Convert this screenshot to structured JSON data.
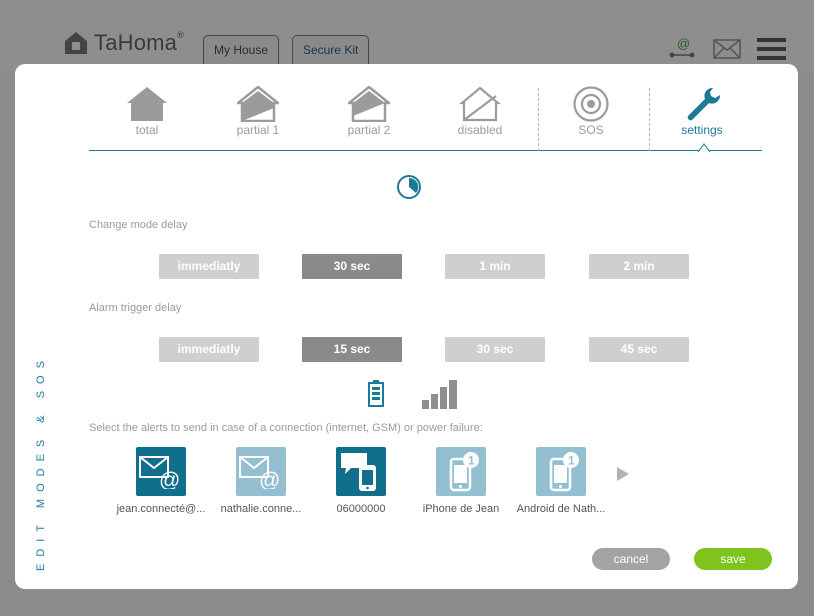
{
  "header": {
    "logo_text": "TaHoma",
    "logo_mark": "®",
    "tabs": [
      {
        "label": "My House"
      },
      {
        "label": "Secure Kit"
      }
    ],
    "icons": [
      "at-network-icon",
      "mail-icon",
      "menu-icon"
    ]
  },
  "side_label": "EDIT MODES & SOS",
  "modes": [
    {
      "label": "total",
      "icon": "house-filled-icon"
    },
    {
      "label": "partial 1",
      "icon": "house-partial-icon"
    },
    {
      "label": "partial 2",
      "icon": "house-partial-icon"
    },
    {
      "label": "disabled",
      "icon": "house-outline-icon"
    },
    {
      "label": "SOS",
      "icon": "sos-target-icon"
    },
    {
      "label": "settings",
      "icon": "wrench-icon",
      "active": true
    }
  ],
  "change_mode_delay": {
    "label": "Change mode delay",
    "options": [
      "immediatly",
      "30 sec",
      "1 min",
      "2 min"
    ],
    "selected": "30 sec"
  },
  "alarm_trigger_delay": {
    "label": "Alarm trigger delay",
    "options": [
      "immediatly",
      "15 sec",
      "30 sec",
      "45 sec"
    ],
    "selected": "15 sec"
  },
  "alerts": {
    "label": "Select the alerts to send in case of a connection (internet, GSM) or power failure:",
    "items": [
      {
        "label": "jean.connecté@...",
        "icon": "email-icon",
        "selected": true
      },
      {
        "label": "nathalie.conne...",
        "icon": "email-icon",
        "selected": false
      },
      {
        "label": "06000000",
        "icon": "sms-phone-icon",
        "selected": true
      },
      {
        "label": "iPhone de Jean",
        "icon": "phone-notification-icon",
        "selected": false,
        "badge": "1"
      },
      {
        "label": "Android de Nath...",
        "icon": "phone-notification-icon",
        "selected": false,
        "badge": "1"
      }
    ]
  },
  "buttons": {
    "cancel": "cancel",
    "save": "save"
  },
  "colors": {
    "accent": "#1c7a99",
    "selected_option": "#8a8a8a",
    "unselected_option": "#cfcfcf",
    "save": "#7fc31e",
    "cancel": "#a3a3a3"
  }
}
